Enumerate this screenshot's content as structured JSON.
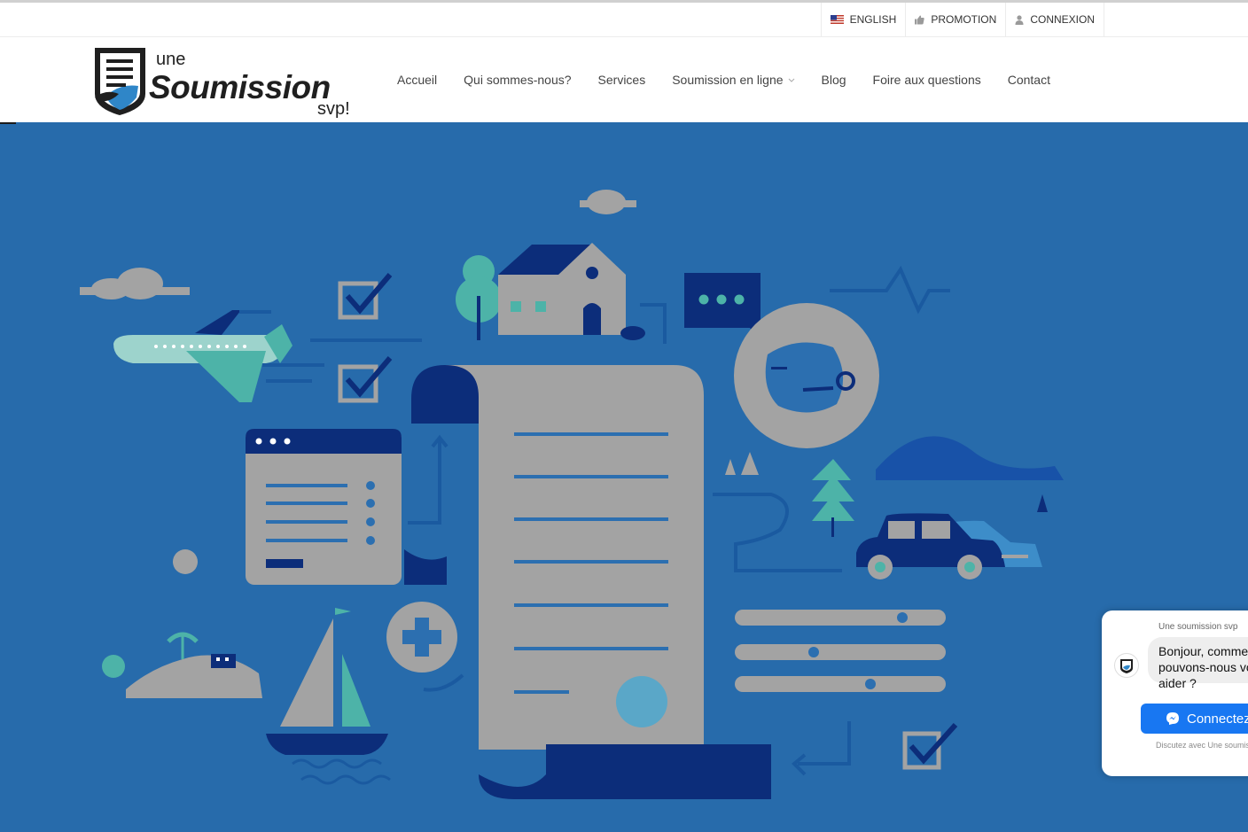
{
  "utility_bar": {
    "items": [
      {
        "label": "ENGLISH",
        "icon": "us-flag-icon"
      },
      {
        "label": "PROMOTION",
        "icon": "thumbs-up-icon"
      },
      {
        "label": "CONNEXION",
        "icon": "user-icon"
      }
    ]
  },
  "logo": {
    "une": "une",
    "brand": "Soumission",
    "svp": "svp!"
  },
  "nav": {
    "items": [
      {
        "label": "Accueil"
      },
      {
        "label": "Qui sommes-nous?"
      },
      {
        "label": "Services"
      },
      {
        "label": "Soumission en ligne",
        "icon": "chevron-down-icon"
      },
      {
        "label": "Blog"
      },
      {
        "label": "Foire aux questions"
      },
      {
        "label": "Contact"
      }
    ]
  },
  "chat_widget": {
    "title": "Une soumission svp",
    "message": "Bonjour, comment pouvons-nous vous aider ?",
    "button_label": "Connectez",
    "button_icon": "messenger-icon",
    "footer": "Discutez avec Une soumission svp"
  },
  "colors": {
    "hero_bg": "#276bab",
    "navy": "#0c2d7a",
    "grey": "#a3a3a3",
    "teal": "#4db3a8",
    "messenger_blue": "#1877f2"
  }
}
